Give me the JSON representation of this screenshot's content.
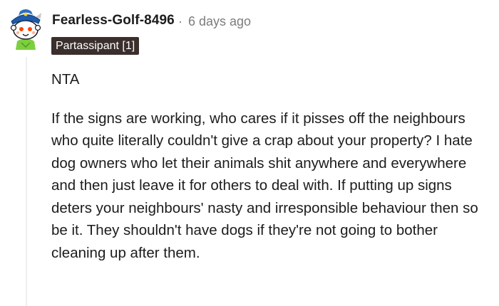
{
  "comment": {
    "author": "Fearless-Golf-8496",
    "separator": "·",
    "timestamp": "6 days ago",
    "flair": "Partassipant [1]",
    "paragraphs": [
      "NTA",
      "If the signs are working, who cares if it pisses off the neighbours who quite literally couldn't give a crap about your property? I hate dog owners who let their animals shit anywhere and everywhere and then just leave it for others to deal with. If putting up signs deters your neighbours' nasty and irresponsible behaviour then so be it. They shouldn't have dogs if they're not going to bother cleaning up after them."
    ],
    "avatar_icon": "snoo-avatar-icon",
    "colors": {
      "flair_background": "#3a2f2c",
      "meta_text": "#7c7c7c",
      "thread_line": "#edeff1",
      "avatar_hat": "#1f5ba8",
      "avatar_body": "#7dcf3e"
    }
  }
}
